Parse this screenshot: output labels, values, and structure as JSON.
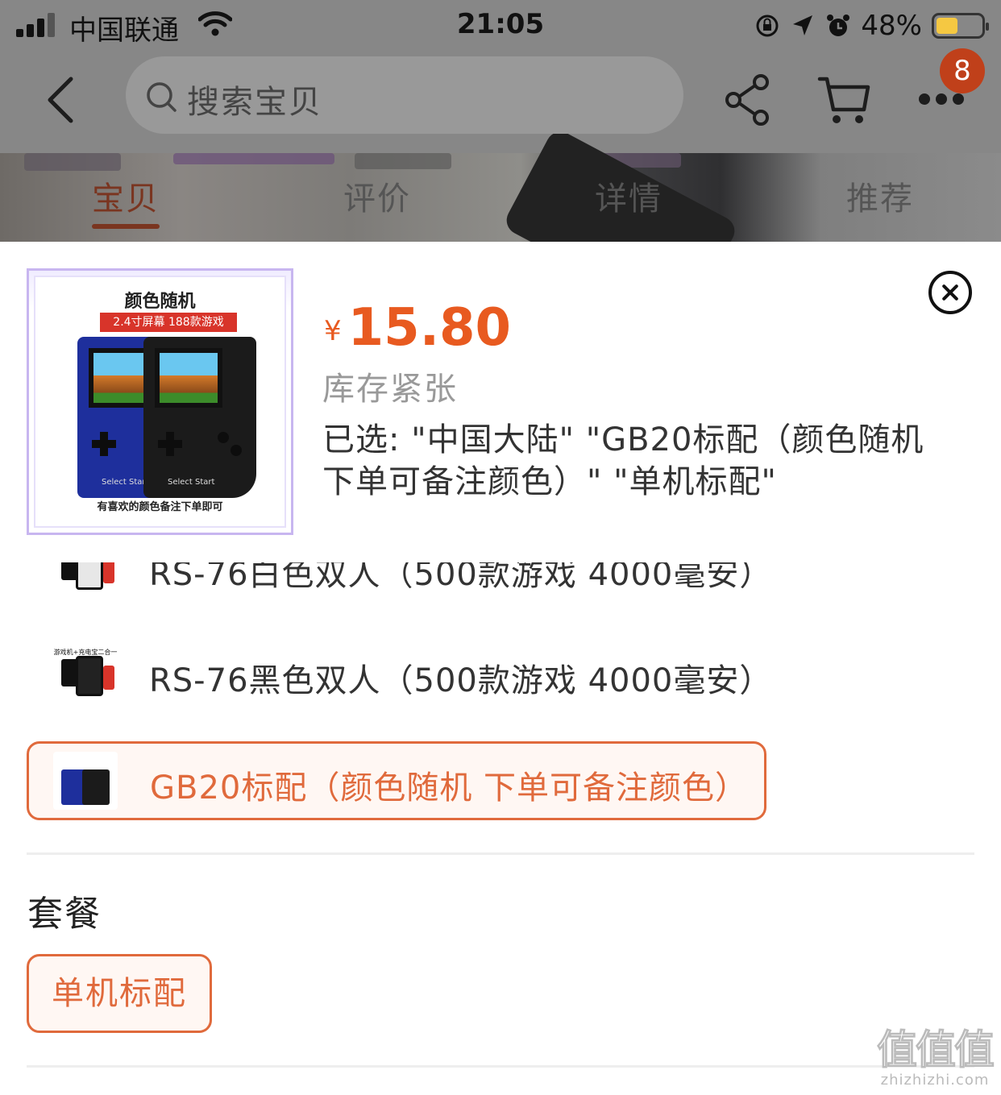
{
  "status_bar": {
    "carrier": "中国联通",
    "time": "21:05",
    "battery_percent": "48%",
    "battery_level": 0.48,
    "signal_bars": 3
  },
  "nav": {
    "search_placeholder": "搜索宝贝",
    "badge_count": "8",
    "icons": [
      "back-icon",
      "search-icon",
      "share-icon",
      "cart-icon",
      "more-icon"
    ]
  },
  "tabs": [
    {
      "label": "宝贝",
      "active": true
    },
    {
      "label": "评价",
      "active": false
    },
    {
      "label": "详情",
      "active": false
    },
    {
      "label": "推荐",
      "active": false
    }
  ],
  "product": {
    "thumb_title": "颜色随机",
    "thumb_subtitle": "2.4寸屏幕 188款游戏",
    "thumb_footer": "有喜欢的颜色备注下单即可",
    "thumb_btn_label": "Select  Start",
    "currency": "¥",
    "price": "15.80",
    "stock_status": "库存紧张",
    "selected_text": "已选: \"中国大陆\" \"GB20标配（颜色随机 下单可备注颜色）\" \"单机标配\""
  },
  "options": [
    {
      "label": "RS-76白色双人（500款游戏  4000毫安）",
      "selected": false
    },
    {
      "label": "RS-76黑色双人（500款游戏  4000毫安）",
      "selected": false,
      "thumb_caption": "游戏机+充电宝二合一"
    },
    {
      "label": "GB20标配（颜色随机 下单可备注颜色）",
      "selected": true
    }
  ],
  "package_group": {
    "title": "套餐",
    "choice": "单机标配"
  },
  "watermark": {
    "mark": "值值值",
    "site": "zhizhizhi.com"
  },
  "colors": {
    "accent": "#e85a20",
    "selected_border": "#e06a3c",
    "badge": "#c0401a"
  }
}
